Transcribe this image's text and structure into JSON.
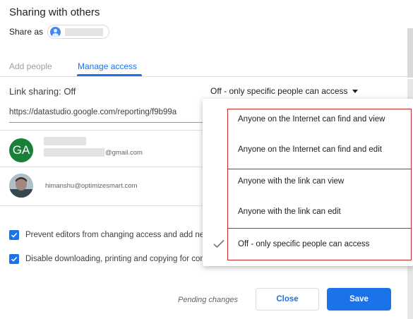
{
  "dialog": {
    "title": "Sharing with others",
    "share_as_label": "Share as"
  },
  "tabs": {
    "add_people": "Add people",
    "manage_access": "Manage access"
  },
  "link_sharing": {
    "label": "Link sharing: Off",
    "selected": "Off - only specific people can access",
    "url": "https://datastudio.google.com/reporting/f9b99a"
  },
  "people": [
    {
      "initials": "GA",
      "email": "@gmail.com",
      "avatar_color": "#188038"
    },
    {
      "email": "himanshu@optimizesmart.com"
    }
  ],
  "options": {
    "prevent_editors": "Prevent editors from changing access and add new people",
    "disable_downloading": "Disable downloading, printing and copying for commenters and viewers"
  },
  "footer": {
    "pending": "Pending changes",
    "close": "Close",
    "save": "Save"
  },
  "dropdown_menu": {
    "items": [
      "Anyone on the Internet can find and view",
      "Anyone on the Internet can find and edit",
      "Anyone with the link can view",
      "Anyone with the link can edit",
      "Off - only specific people can access"
    ],
    "checked_index": 4
  },
  "colors": {
    "accent": "#1a73e8",
    "highlight_border": "#c62828"
  }
}
